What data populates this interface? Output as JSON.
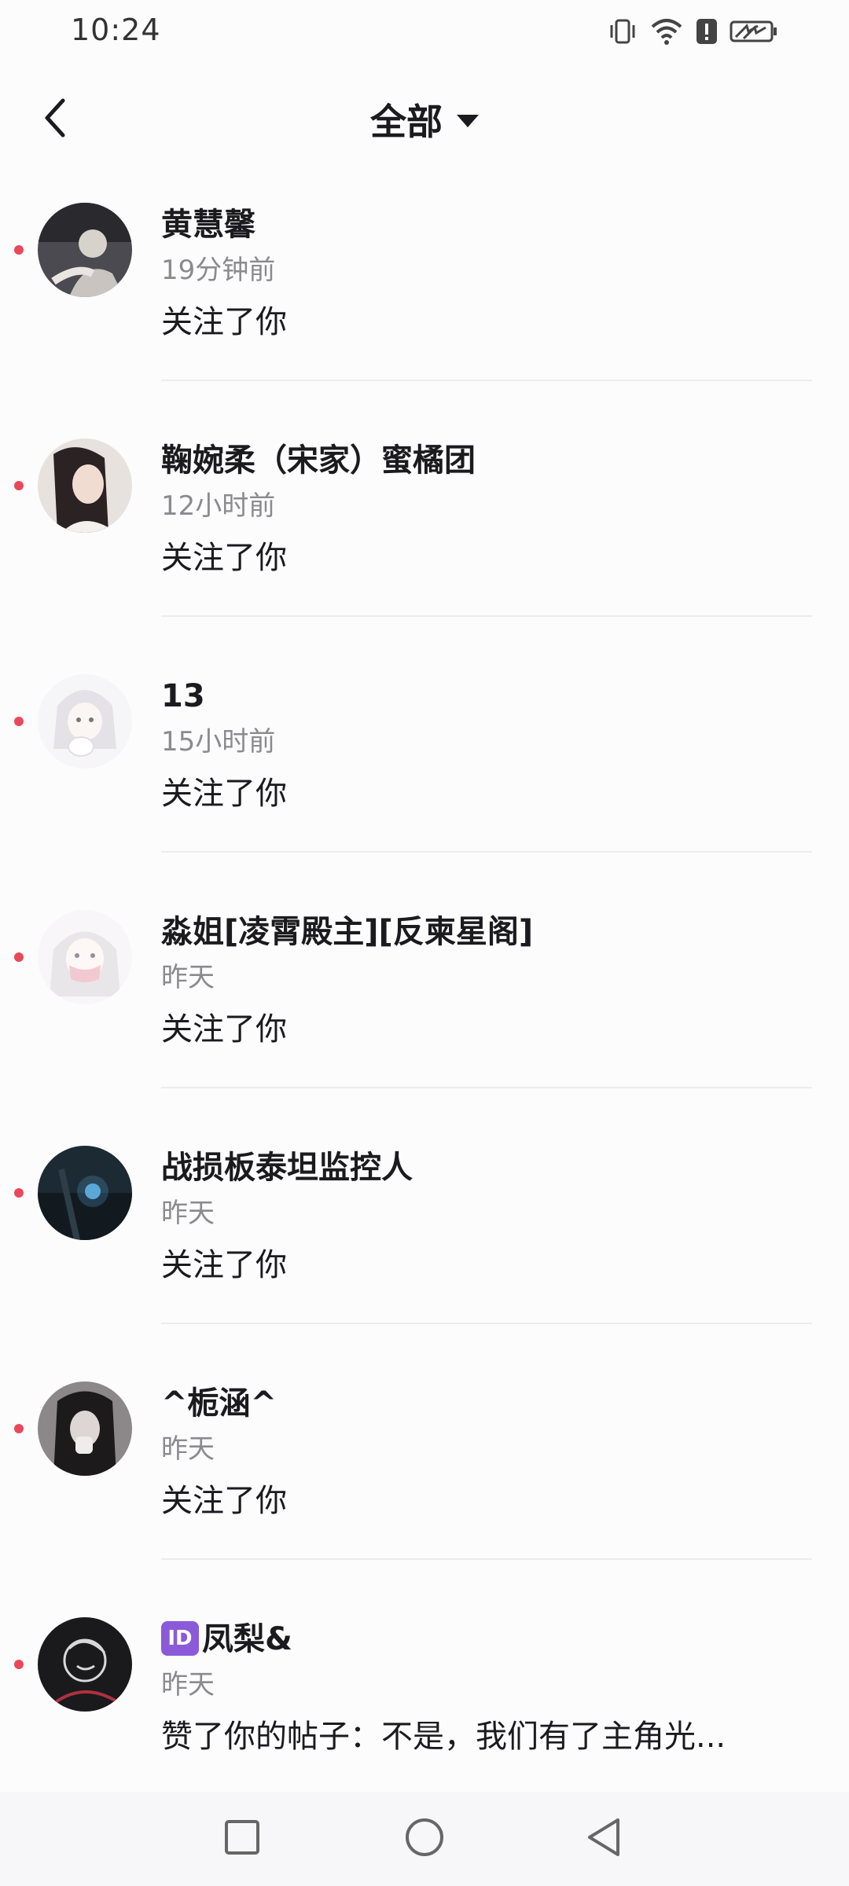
{
  "status_bar": {
    "time": "10:24",
    "icons": [
      "vibrate-icon",
      "wifi-icon",
      "alert-icon",
      "battery-charging-icon"
    ]
  },
  "header": {
    "back_icon": "chevron-left-icon",
    "filter_label": "全部",
    "filter_icon": "caret-down-icon"
  },
  "notifications": [
    {
      "name": "黄慧馨",
      "time": "19分钟前",
      "text": "关注了你",
      "unread": true,
      "avatar_color": "#4a4a50"
    },
    {
      "name": "鞠婉柔（宋家）蜜橘团",
      "time": "12小时前",
      "text": "关注了你",
      "unread": true,
      "avatar_color": "#d9c8c0"
    },
    {
      "name": "13",
      "time": "15小时前",
      "text": "关注了你",
      "unread": true,
      "avatar_color": "#ececf0"
    },
    {
      "name": "淼姐[凌霄殿主][反柬星阁]",
      "time": "昨天",
      "text": "关注了你",
      "unread": true,
      "avatar_color": "#f2eef0"
    },
    {
      "name": "战损板泰坦监控人",
      "time": "昨天",
      "text": "关注了你",
      "unread": true,
      "avatar_color": "#1c2a33"
    },
    {
      "name": "^栀涵^",
      "time": "昨天",
      "text": "关注了你",
      "unread": true,
      "avatar_color": "#6e6a6c"
    },
    {
      "badge": "ID",
      "name": "凤梨&",
      "time": "昨天",
      "text": "赞了你的帖子：不是，我们有了主角光...",
      "unread": true,
      "avatar_color": "#1a1a1c"
    }
  ],
  "nav_bar": {
    "recents_icon": "square-icon",
    "home_icon": "circle-icon",
    "back_icon": "triangle-back-icon"
  },
  "colors": {
    "unread_dot": "#e8495a",
    "secondary_text": "#8a8a8f",
    "badge": "#8b5ad9"
  }
}
